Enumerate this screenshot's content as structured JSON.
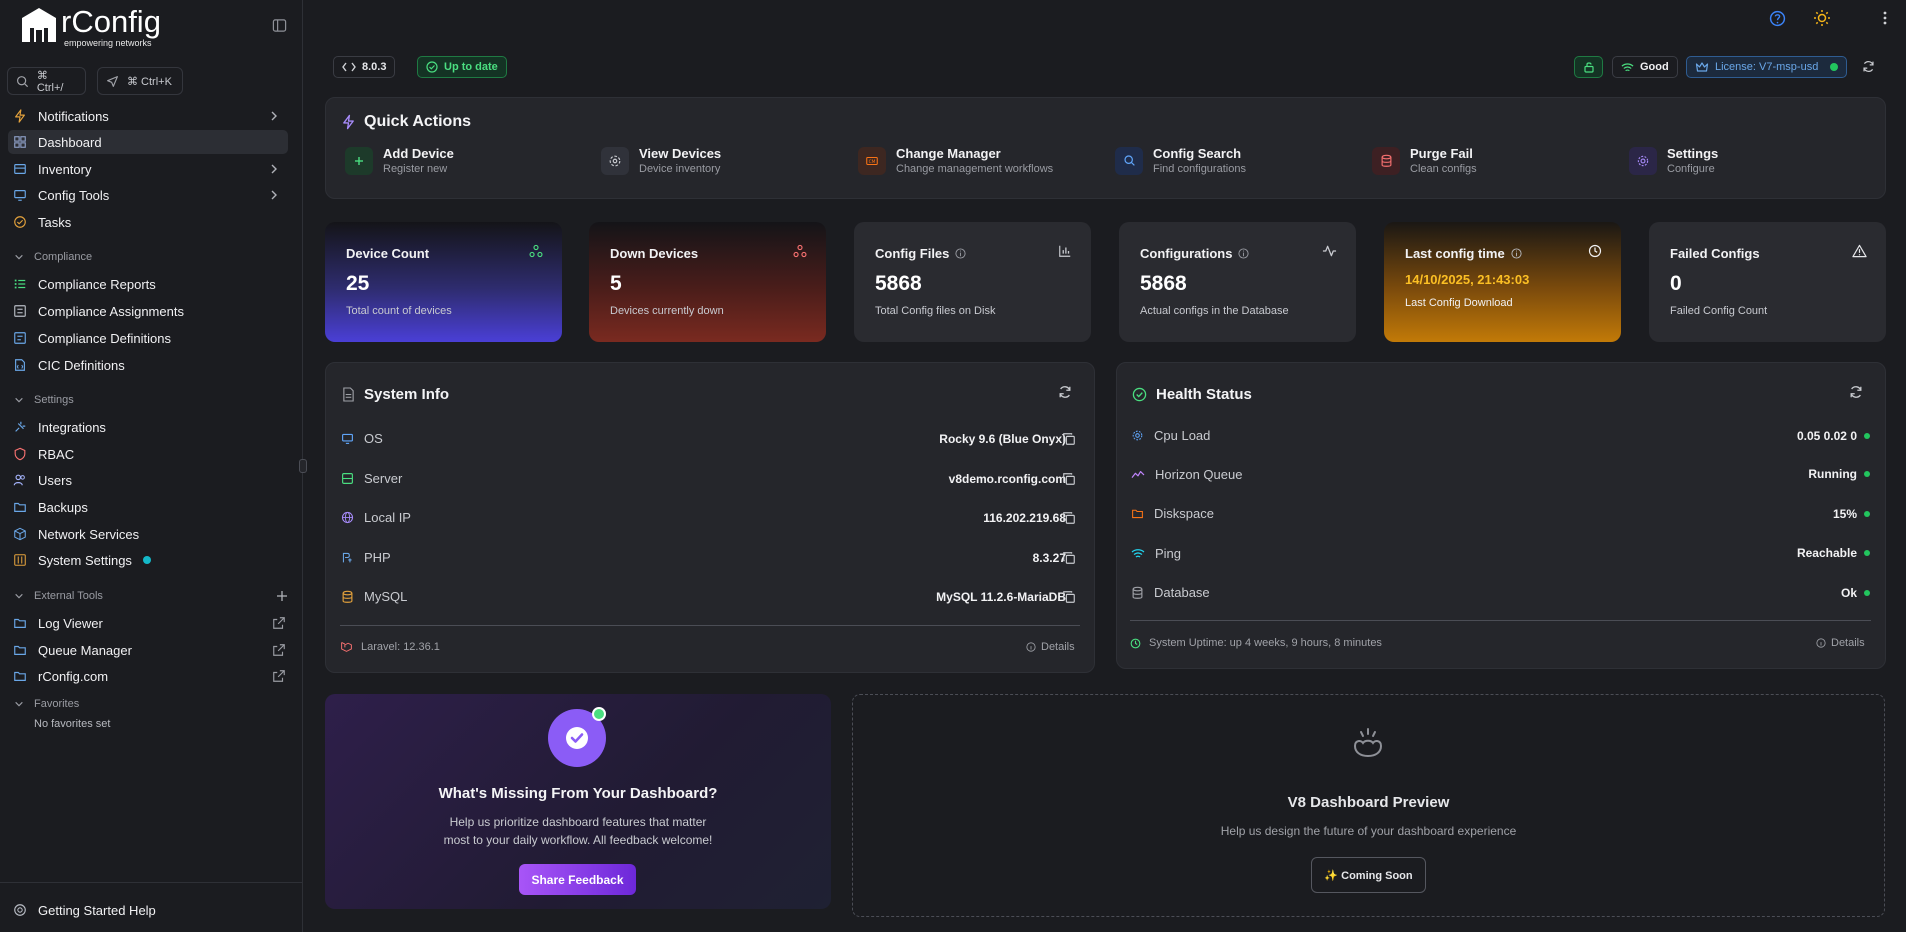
{
  "app": {
    "name": "rConfig",
    "tagline": "empowering networks"
  },
  "search": {
    "shortcut1": "⌘ Ctrl+/",
    "shortcut2": "⌘ Ctrl+K"
  },
  "sidebar": {
    "notifications": "Notifications",
    "dashboard": "Dashboard",
    "inventory": "Inventory",
    "config_tools": "Config Tools",
    "tasks": "Tasks",
    "compliance_h": "Compliance",
    "compliance_reports": "Compliance Reports",
    "compliance_assignments": "Compliance Assignments",
    "compliance_definitions": "Compliance Definitions",
    "cic_definitions": "CIC Definitions",
    "settings_h": "Settings",
    "integrations": "Integrations",
    "rbac": "RBAC",
    "users": "Users",
    "backups": "Backups",
    "network_services": "Network Services",
    "system_settings": "System Settings",
    "external_tools_h": "External Tools",
    "log_viewer": "Log Viewer",
    "queue_manager": "Queue Manager",
    "rconfig_com": "rConfig.com",
    "favorites_h": "Favorites",
    "no_favorites": "No favorites set",
    "getting_started": "Getting Started Help"
  },
  "topbar": {
    "version": "8.0.3",
    "status": "Up to date",
    "signal": "Good",
    "license": "License: V7-msp-usd"
  },
  "quick_actions": {
    "title": "Quick Actions",
    "items": [
      {
        "title": "Add Device",
        "sub": "Register new"
      },
      {
        "title": "View Devices",
        "sub": "Device inventory"
      },
      {
        "title": "Change Manager",
        "sub": "Change management workflows"
      },
      {
        "title": "Config Search",
        "sub": "Find configurations"
      },
      {
        "title": "Purge Fail",
        "sub": "Clean configs"
      },
      {
        "title": "Settings",
        "sub": "Configure"
      }
    ]
  },
  "stats": [
    {
      "title": "Device Count",
      "value": "25",
      "sub": "Total count of devices"
    },
    {
      "title": "Down Devices",
      "value": "5",
      "sub": "Devices currently down"
    },
    {
      "title": "Config Files",
      "value": "5868",
      "sub": "Total Config files on Disk"
    },
    {
      "title": "Configurations",
      "value": "5868",
      "sub": "Actual configs in the Database"
    },
    {
      "title": "Last config time",
      "value": "14/10/2025, 21:43:03",
      "sub": "Last Config Download"
    },
    {
      "title": "Failed Configs",
      "value": "0",
      "sub": "Failed Config Count"
    }
  ],
  "system_info": {
    "title": "System Info",
    "rows": [
      {
        "label": "OS",
        "value": "Rocky 9.6 (Blue Onyx)"
      },
      {
        "label": "Server",
        "value": "v8demo.rconfig.com"
      },
      {
        "label": "Local IP",
        "value": "116.202.219.68"
      },
      {
        "label": "PHP",
        "value": "8.3.27"
      },
      {
        "label": "MySQL",
        "value": "MySQL 11.2.6-MariaDB"
      }
    ],
    "footer": "Laravel: 12.36.1",
    "details": "Details"
  },
  "health": {
    "title": "Health Status",
    "rows": [
      {
        "label": "Cpu Load",
        "value": "0.05 0.02 0"
      },
      {
        "label": "Horizon Queue",
        "value": "Running"
      },
      {
        "label": "Diskspace",
        "value": "15%"
      },
      {
        "label": "Ping",
        "value": "Reachable"
      },
      {
        "label": "Database",
        "value": "Ok"
      }
    ],
    "footer": "System Uptime: up 4 weeks, 9 hours, 8 minutes",
    "details": "Details"
  },
  "feedback": {
    "title": "What's Missing From Your Dashboard?",
    "line1": "Help us prioritize dashboard features that matter",
    "line2": "most to your daily workflow. All feedback welcome!",
    "button": "Share Feedback"
  },
  "preview": {
    "title": "V8 Dashboard Preview",
    "sub": "Help us design the future of your dashboard experience",
    "button": "✨ Coming Soon"
  },
  "colors": {
    "accent": "#8b5cf6",
    "good": "#22c55e",
    "orange": "#f59e0b",
    "blue": "#3b82f6"
  }
}
